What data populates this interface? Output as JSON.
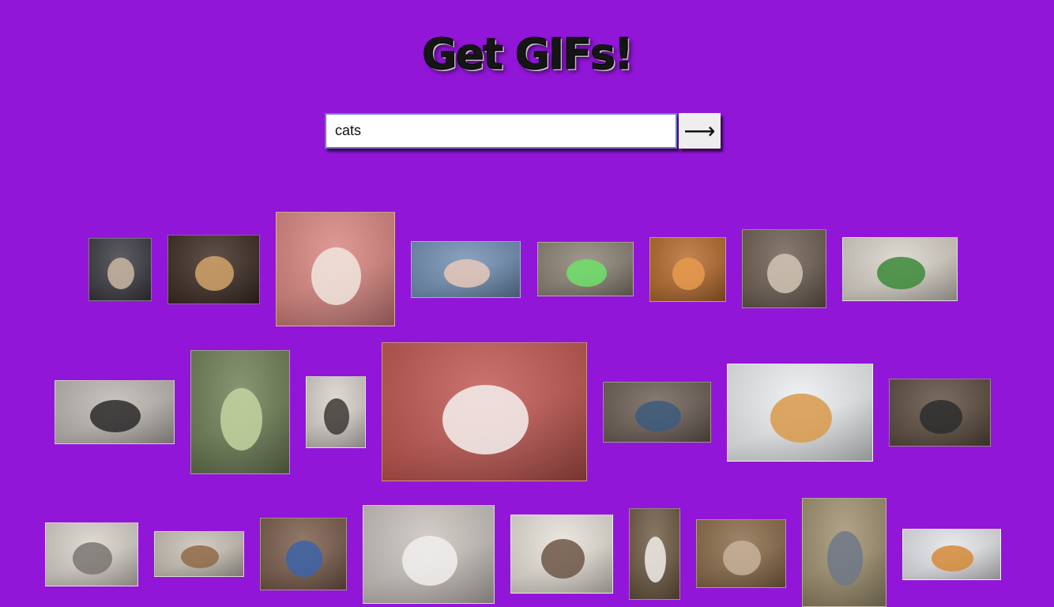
{
  "app": {
    "title": "Get GIFs!"
  },
  "search": {
    "value": "cats",
    "submit_label": "⟶"
  },
  "results": [
    {
      "name": "gif-cat-motorcycle",
      "bg": "#3a3a42",
      "accent": "#c9b7a2"
    },
    {
      "name": "gif-cats-couch",
      "bg": "#3b2b22",
      "accent": "#d2a36a"
    },
    {
      "name": "gif-cats-pink-blanket",
      "bg": "#d9857f",
      "accent": "#f0e6de"
    },
    {
      "name": "gif-cats-flower-hats",
      "bg": "#6f8fb3",
      "accent": "#e8c8b8"
    },
    {
      "name": "gif-cat-lightsaber",
      "bg": "#8b8274",
      "accent": "#6fe06a"
    },
    {
      "name": "gif-cats-orange-cuddle",
      "bg": "#b56a2c",
      "accent": "#e69a4d"
    },
    {
      "name": "gif-cat-wide-eyes",
      "bg": "#6d5e52",
      "accent": "#d2c4b5"
    },
    {
      "name": "gif-cats-watermelon-hats",
      "bg": "#d8d2c8",
      "accent": "#3c8a3a"
    },
    {
      "name": "gif-cats-many-floor",
      "bg": "#bdb7b2",
      "accent": "#2c2a2a"
    },
    {
      "name": "gif-cats-glass-door",
      "bg": "#6f7f55",
      "accent": "#c3d4a0"
    },
    {
      "name": "gif-cat-hiding",
      "bg": "#d9d3cc",
      "accent": "#3f3a36"
    },
    {
      "name": "gif-cat-persian-hat",
      "bg": "#c0554f",
      "accent": "#f4f1ee"
    },
    {
      "name": "gif-cats-mirror-floor",
      "bg": "#6c5e55",
      "accent": "#3d5a7d"
    },
    {
      "name": "gif-cat-calico-white",
      "bg": "#eceef0",
      "accent": "#d89a4a"
    },
    {
      "name": "gif-cats-fighting-room",
      "bg": "#5c4c3e",
      "accent": "#2d2d2d"
    },
    {
      "name": "gif-cat-grey-walking",
      "bg": "#d8d2c9",
      "accent": "#7a7672"
    },
    {
      "name": "gif-kittens-lineup",
      "bg": "#c9c2b6",
      "accent": "#8f6a46"
    },
    {
      "name": "gif-cat-yarn",
      "bg": "#7a5c4a",
      "accent": "#3c63a8"
    },
    {
      "name": "gif-cats-hugging",
      "bg": "#c9c3bd",
      "accent": "#f1efee"
    },
    {
      "name": "gif-cat-bathroom",
      "bg": "#e7e2d9",
      "accent": "#6d5646"
    },
    {
      "name": "gif-cats-stacked",
      "bg": "#6f5b42",
      "accent": "#f0ece8"
    },
    {
      "name": "gif-cats-doorway",
      "bg": "#8a6a48",
      "accent": "#c8b29a"
    },
    {
      "name": "gif-cat-grey-fence",
      "bg": "#a0916f",
      "accent": "#6d7888"
    },
    {
      "name": "gif-cats-dj-turntables",
      "bg": "#e5e6ea",
      "accent": "#d58a3a"
    }
  ]
}
